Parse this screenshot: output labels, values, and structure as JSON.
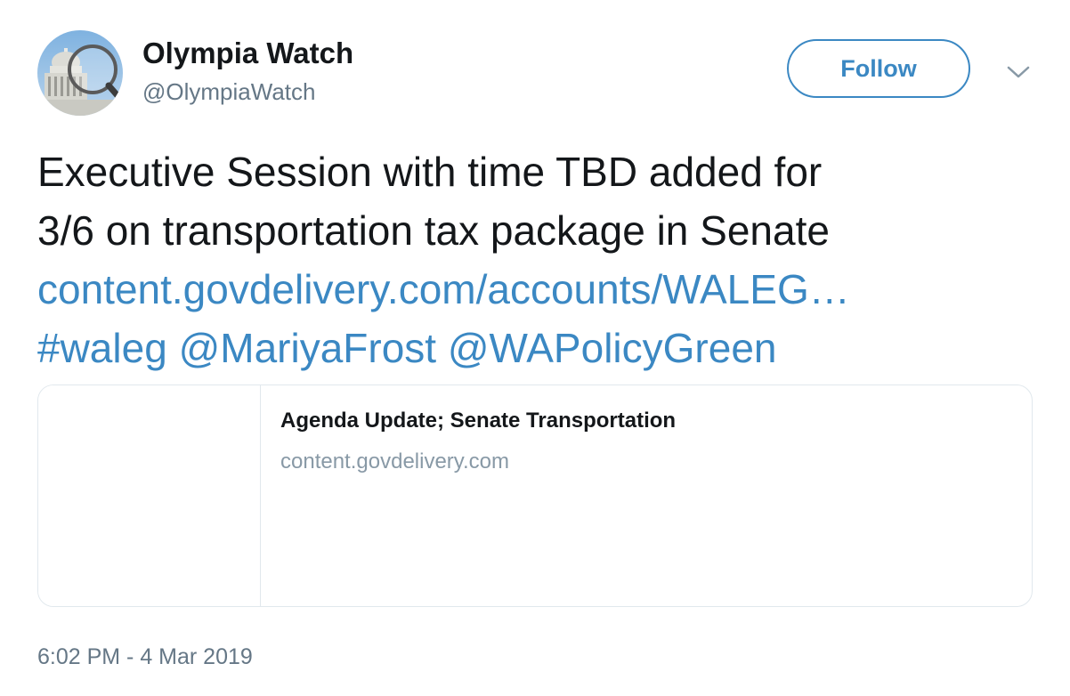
{
  "header": {
    "display_name": "Olympia Watch",
    "handle": "@OlympiaWatch",
    "follow_label": "Follow",
    "avatar_icon": "capitol-dome-avatar",
    "menu_icon": "chevron-down-icon"
  },
  "tweet": {
    "line1": "Executive Session with time TBD added for",
    "line2": "3/6 on transportation tax package in Senate",
    "link_url_text": "content.govdelivery.com/accounts/WALEG…",
    "hashtag": "#waleg",
    "mention1": "@MariyaFrost",
    "mention2": "@WAPolicyGreen"
  },
  "card": {
    "title": "Agenda Update; Senate Transportation",
    "domain": "content.govdelivery.com"
  },
  "timestamp": "6:02 PM - 4 Mar 2019",
  "colors": {
    "accent": "#3b88c3",
    "text": "#14171a",
    "secondary": "#657786",
    "border": "#e1e8ed"
  }
}
